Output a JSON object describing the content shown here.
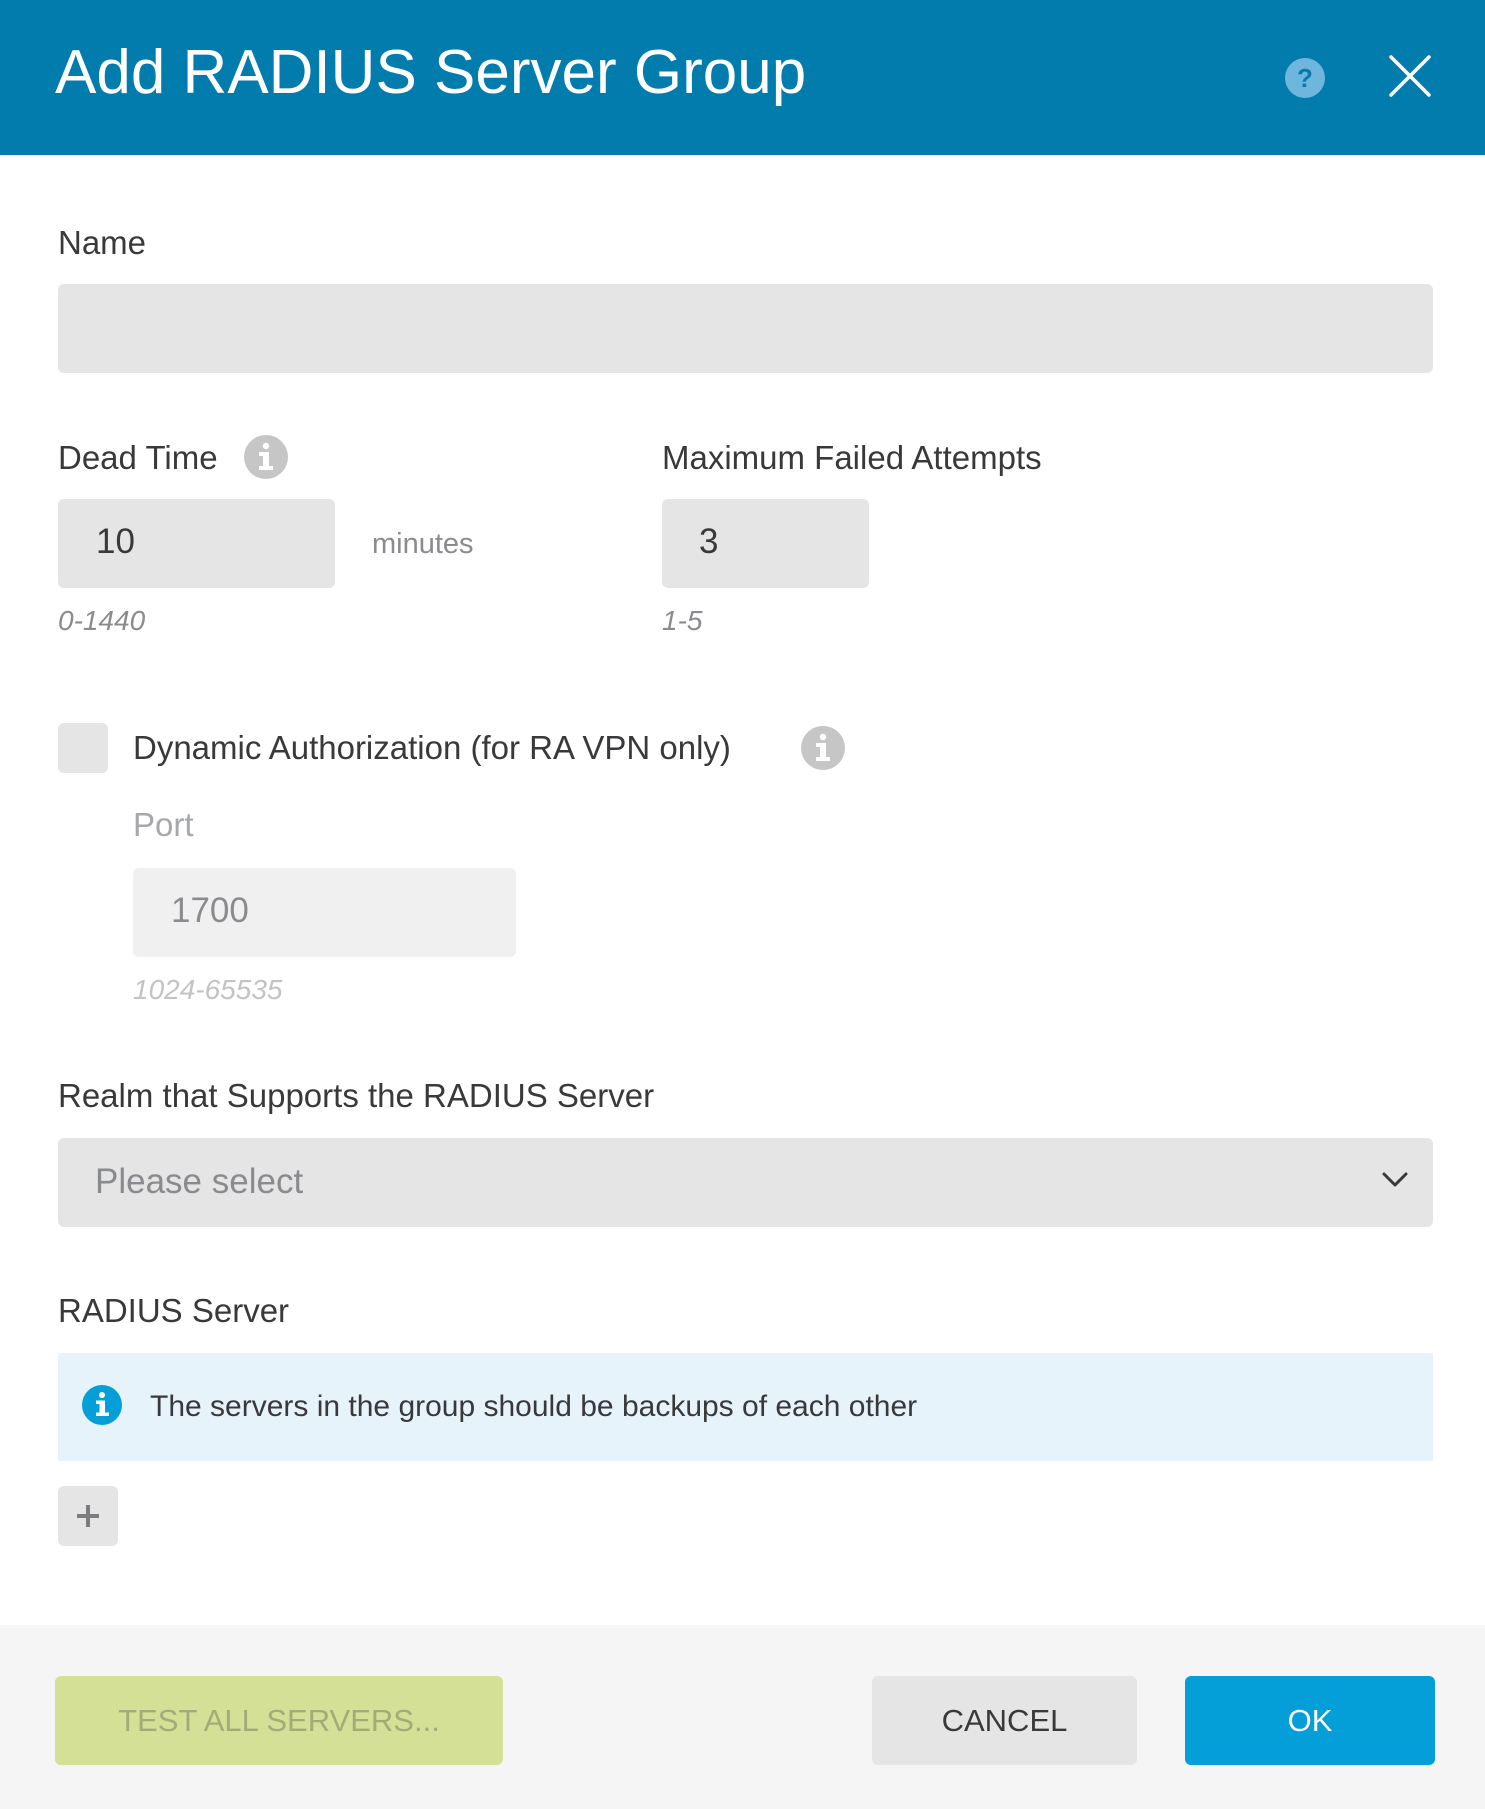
{
  "dialog": {
    "title": "Add RADIUS Server Group"
  },
  "icons": {
    "help": "help-icon",
    "close": "close-icon",
    "info": "info-icon",
    "chevron": "chevron-down-icon",
    "plus": "plus-icon"
  },
  "colors": {
    "header": "#017cad",
    "ok_button": "#049fd9",
    "test_button": "#d3e096",
    "info_banner": "#e6f3fb",
    "info_icon": "#049fd9"
  },
  "form": {
    "name": {
      "label": "Name",
      "value": ""
    },
    "dead_time": {
      "label": "Dead Time",
      "value": "10",
      "unit": "minutes",
      "range": "0-1440"
    },
    "max_failed_attempts": {
      "label": "Maximum Failed Attempts",
      "value": "3",
      "range": "1-5"
    },
    "dynamic_authorization": {
      "label": "Dynamic Authorization (for RA VPN only)",
      "checked": false,
      "port_label": "Port",
      "port_value": "1700",
      "port_range": "1024-65535"
    },
    "realm": {
      "label": "Realm that Supports the RADIUS Server",
      "placeholder": "Please select"
    },
    "radius_server": {
      "label": "RADIUS Server",
      "info": "The servers in the group should be backups of each other"
    }
  },
  "footer": {
    "test_all_label": "TEST ALL SERVERS...",
    "cancel_label": "CANCEL",
    "ok_label": "OK"
  }
}
